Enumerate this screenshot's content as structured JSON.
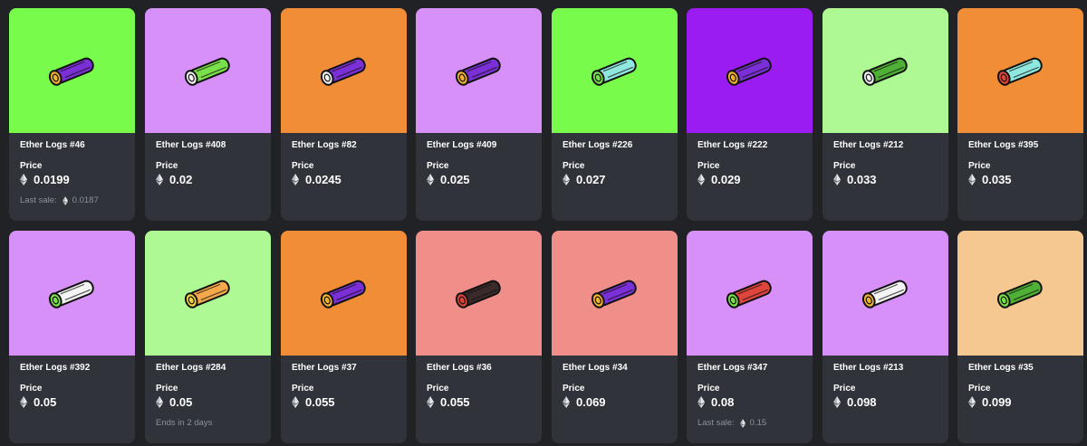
{
  "cards": [
    {
      "name": "Ether Logs #46",
      "price_label": "Price",
      "price": "0.0199",
      "bg": "#78fb4a",
      "fill": "#7b2fd6",
      "tip": "#f2b230",
      "extra_label": "Last sale:",
      "extra_value": "0.0187"
    },
    {
      "name": "Ether Logs #408",
      "price_label": "Price",
      "price": "0.02",
      "bg": "#d690f7",
      "fill": "#7ae049",
      "tip": "#f4f4f4"
    },
    {
      "name": "Ether Logs #82",
      "price_label": "Price",
      "price": "0.0245",
      "bg": "#f08d36",
      "fill": "#7b2fd6",
      "tip": "#f4f4f4"
    },
    {
      "name": "Ether Logs #409",
      "price_label": "Price",
      "price": "0.025",
      "bg": "#d690f7",
      "fill": "#7b2fd6",
      "tip": "#f2b230"
    },
    {
      "name": "Ether Logs #226",
      "price_label": "Price",
      "price": "0.027",
      "bg": "#78fb4a",
      "fill": "#8fe8e0",
      "tip": "#7ae049"
    },
    {
      "name": "Ether Logs #222",
      "price_label": "Price",
      "price": "0.029",
      "bg": "#9a1cf0",
      "fill": "#7b2fd6",
      "tip": "#f2b230"
    },
    {
      "name": "Ether Logs #212",
      "price_label": "Price",
      "price": "0.033",
      "bg": "#aef994",
      "fill": "#4fb036",
      "tip": "#f4f4f4"
    },
    {
      "name": "Ether Logs #395",
      "price_label": "Price",
      "price": "0.035",
      "bg": "#f08d36",
      "fill": "#8fe8e0",
      "tip": "#e0453c"
    },
    {
      "name": "Ether Logs #392",
      "price_label": "Price",
      "price": "0.05",
      "bg": "#d690f7",
      "fill": "#f4f4f4",
      "tip": "#7ae049"
    },
    {
      "name": "Ether Logs #284",
      "price_label": "Price",
      "price": "0.05",
      "bg": "#aef994",
      "fill": "#f5a94a",
      "tip": "#f2d440",
      "extra_text": "Ends in 2 days"
    },
    {
      "name": "Ether Logs #37",
      "price_label": "Price",
      "price": "0.055",
      "bg": "#f08d36",
      "fill": "#7b2fd6",
      "tip": "#f2b230"
    },
    {
      "name": "Ether Logs #36",
      "price_label": "Price",
      "price": "0.055",
      "bg": "#f08e8a",
      "fill": "#3a2a2a",
      "tip": "#e0453c"
    },
    {
      "name": "Ether Logs #34",
      "price_label": "Price",
      "price": "0.069",
      "bg": "#f08e8a",
      "fill": "#7b2fd6",
      "tip": "#f2b230"
    },
    {
      "name": "Ether Logs #347",
      "price_label": "Price",
      "price": "0.08",
      "bg": "#d690f7",
      "fill": "#e0453c",
      "tip": "#7ae049",
      "extra_label": "Last sale:",
      "extra_value": "0.15"
    },
    {
      "name": "Ether Logs #213",
      "price_label": "Price",
      "price": "0.098",
      "bg": "#d690f7",
      "fill": "#f4f4f4",
      "tip": "#f2b230"
    },
    {
      "name": "Ether Logs #35",
      "price_label": "Price",
      "price": "0.099",
      "bg": "#f5c891",
      "fill": "#4fb036",
      "tip": "#7ae049"
    }
  ],
  "icons": {
    "currency": "ethereum-icon",
    "item_art": "log-icon"
  },
  "colors": {
    "page_bg": "#202225",
    "card_bg": "#303339",
    "muted_text": "#8a939b"
  }
}
